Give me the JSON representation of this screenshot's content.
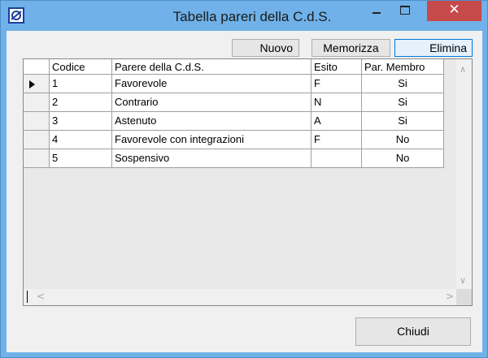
{
  "window": {
    "title": "Tabella pareri della C.d.S.",
    "close_glyph": "✕"
  },
  "toolbar": {
    "new_label": "Nuovo",
    "save_label": "Memorizza",
    "delete_label": "Elimina"
  },
  "table": {
    "headers": {
      "code": "Codice",
      "opinion": "Parere della C.d.S.",
      "outcome": "Esito",
      "member": "Par. Membro"
    },
    "rows": [
      {
        "code": "1",
        "opinion": "Favorevole",
        "outcome": "F",
        "member": "Si"
      },
      {
        "code": "2",
        "opinion": "Contrario",
        "outcome": "N",
        "member": "Si"
      },
      {
        "code": "3",
        "opinion": "Astenuto",
        "outcome": "A",
        "member": "Si"
      },
      {
        "code": "4",
        "opinion": "Favorevole con integrazioni",
        "outcome": "F",
        "member": "No"
      },
      {
        "code": "5",
        "opinion": "Sospensivo",
        "outcome": "",
        "member": "No"
      }
    ],
    "selected_row": 1
  },
  "footer": {
    "close_label": "Chiudi"
  },
  "icons": {
    "app": "app-icon",
    "minimize": "minimize-icon",
    "maximize": "maximize-icon",
    "close": "close-icon",
    "row_pointer": "row-pointer-icon"
  },
  "colors": {
    "titlebar": "#6fb1e8",
    "close_button": "#c74a4b",
    "default_button_border": "#0078d7"
  }
}
